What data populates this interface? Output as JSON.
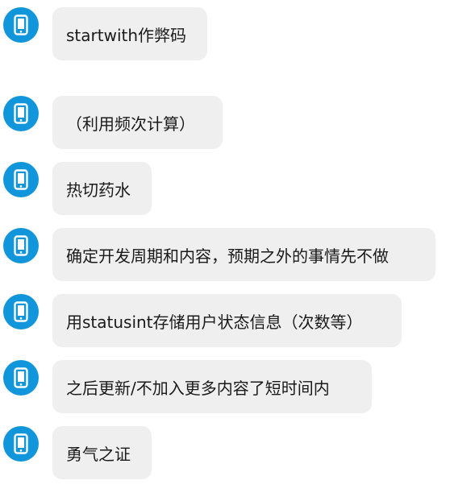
{
  "messages": [
    {
      "text": "startwith作弊码"
    },
    {
      "text": "（利用频次计算）"
    },
    {
      "text": "热切药水"
    },
    {
      "text": "确定开发周期和内容，预期之外的事情先不做"
    },
    {
      "text": "用statusint存储用户状态信息（次数等）"
    },
    {
      "text": "之后更新/不加入更多内容了短时间内"
    },
    {
      "text": "勇气之证"
    }
  ],
  "colors": {
    "avatar": "#1296db",
    "bubble": "#efefef",
    "text": "#1a1a1a"
  },
  "icons": {
    "avatar": "phone-icon"
  }
}
